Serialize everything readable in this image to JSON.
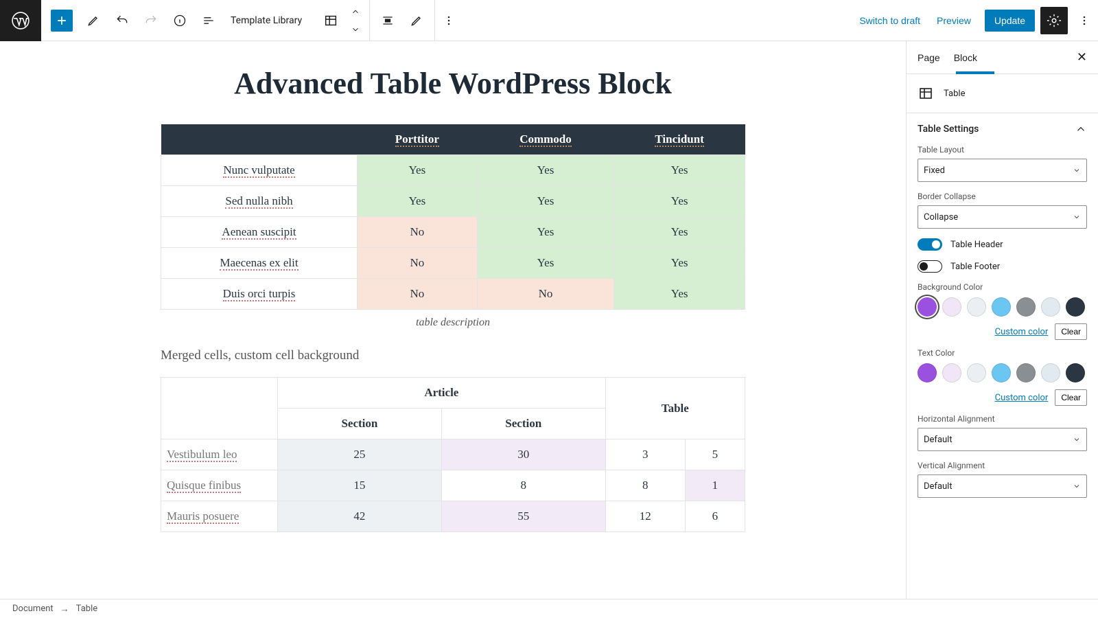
{
  "topbar": {
    "template_library": "Template Library",
    "switch_draft": "Switch to draft",
    "preview": "Preview",
    "update": "Update"
  },
  "page": {
    "title": "Advanced Table WordPress Block",
    "table1": {
      "headers": [
        "",
        "Porttitor",
        "Commodo",
        "Tincidunt"
      ],
      "rows": [
        {
          "label": "Nunc vulputate",
          "cells": [
            "Yes",
            "Yes",
            "Yes"
          ],
          "bg": [
            "g",
            "g",
            "g"
          ]
        },
        {
          "label": "Sed nulla nibh",
          "cells": [
            "Yes",
            "Yes",
            "Yes"
          ],
          "bg": [
            "g",
            "g",
            "g"
          ]
        },
        {
          "label": "Aenean suscipit",
          "cells": [
            "No",
            "Yes",
            "Yes"
          ],
          "bg": [
            "r",
            "g",
            "g"
          ]
        },
        {
          "label": "Maecenas ex elit",
          "cells": [
            "No",
            "Yes",
            "Yes"
          ],
          "bg": [
            "r",
            "g",
            "g"
          ]
        },
        {
          "label": "Duis orci turpis",
          "cells": [
            "No",
            "No",
            "Yes"
          ],
          "bg": [
            "r",
            "r",
            "g"
          ]
        }
      ],
      "caption": "table description"
    },
    "subhead": "Merged cells, custom cell background",
    "table2": {
      "hrow1": [
        "",
        "Article",
        "Table"
      ],
      "hrow2": [
        "Section",
        "Section"
      ],
      "rows": [
        {
          "label": "Vestibulum leo",
          "cells": [
            "25",
            "30",
            "3",
            "5"
          ]
        },
        {
          "label": "Quisque finibus",
          "cells": [
            "15",
            "8",
            "8",
            "1"
          ]
        },
        {
          "label": "Mauris posuere",
          "cells": [
            "42",
            "55",
            "12",
            "6"
          ]
        }
      ]
    }
  },
  "sidebar": {
    "tabs": {
      "page": "Page",
      "block": "Block"
    },
    "block_name": "Table",
    "panel_title": "Table Settings",
    "layout_label": "Table Layout",
    "layout_value": "Fixed",
    "collapse_label": "Border Collapse",
    "collapse_value": "Collapse",
    "header_label": "Table Header",
    "footer_label": "Table Footer",
    "bg_label": "Background Color",
    "text_label": "Text Color",
    "custom_color": "Custom color",
    "clear": "Clear",
    "halign_label": "Horizontal Alignment",
    "halign_value": "Default",
    "valign_label": "Vertical Alignment",
    "valign_value": "Default",
    "swatches": [
      "#9b51e0",
      "#f1e6f7",
      "#ebeff2",
      "#6cc6f2",
      "#8a8f94",
      "#e1eaf0",
      "#2a3642"
    ]
  },
  "breadcrumb": {
    "doc": "Document",
    "node": "Table"
  }
}
